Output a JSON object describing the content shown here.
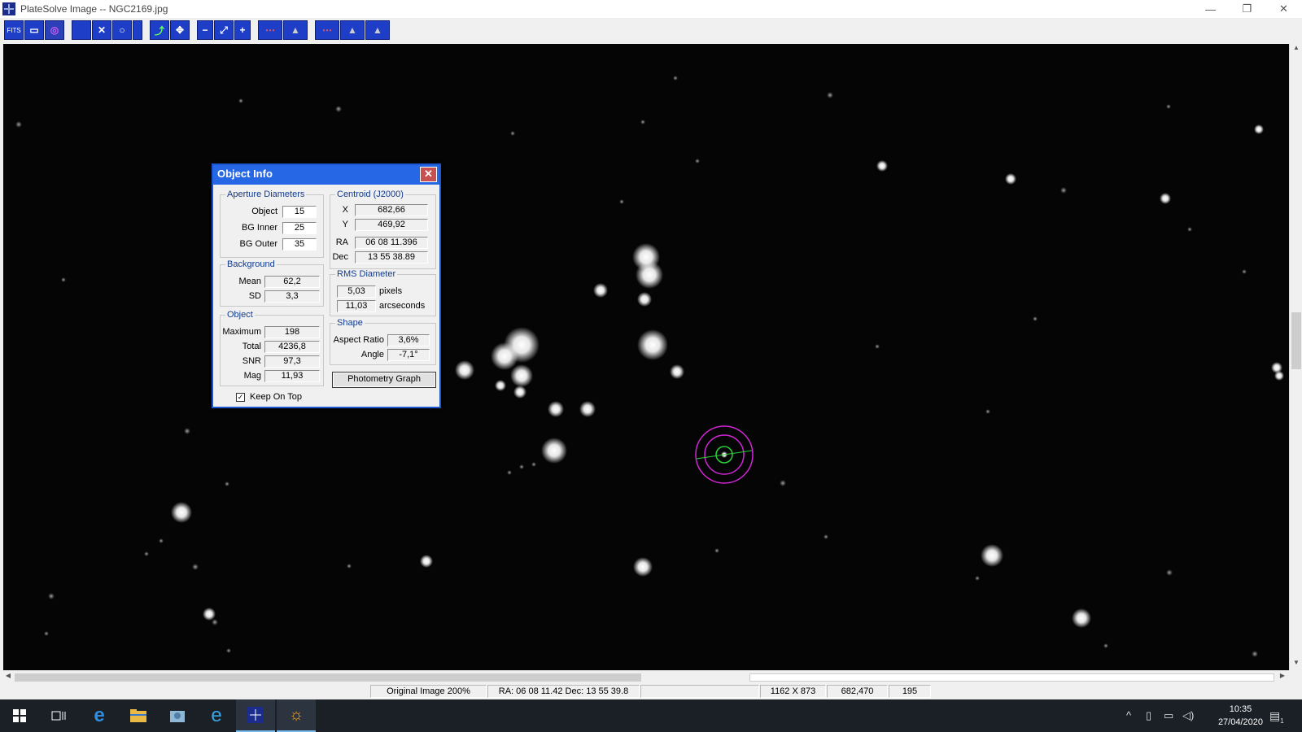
{
  "window": {
    "title": "PlateSolve Image -- NGC2169.jpg",
    "minimize": "—",
    "restore": "❐",
    "close": "✕"
  },
  "toolbar": {
    "buttons": [
      {
        "name": "fits-button",
        "label": "FITS"
      },
      {
        "name": "panel-button",
        "label": "▭"
      },
      {
        "name": "aperture-button",
        "label": "◎"
      },
      {
        "name": "blank-button-1",
        "label": ""
      },
      {
        "name": "cross-button",
        "label": "✕"
      },
      {
        "name": "circle-button",
        "label": "○"
      },
      {
        "name": "blank-button-2",
        "label": ""
      },
      {
        "name": "align-button",
        "label": "⤴"
      },
      {
        "name": "move-button",
        "label": "✥"
      },
      {
        "name": "zoom-out-button",
        "label": "−"
      },
      {
        "name": "fit-button",
        "label": "⤢"
      },
      {
        "name": "zoom-in-button",
        "label": "+"
      },
      {
        "name": "profile-h-button",
        "label": "⋯"
      },
      {
        "name": "peak-button",
        "label": "▲"
      },
      {
        "name": "profile-v-button",
        "label": "⋯"
      },
      {
        "name": "peak2-button",
        "label": "▲"
      },
      {
        "name": "peak3-button",
        "label": "▲"
      }
    ]
  },
  "dialog": {
    "title": "Object Info",
    "close": "✕",
    "aperture": {
      "label": "Aperture Diameters",
      "object_label": "Object",
      "object": "15",
      "bg_inner_label": "BG Inner",
      "bg_inner": "25",
      "bg_outer_label": "BG Outer",
      "bg_outer": "35"
    },
    "centroid": {
      "label": "Centroid (J2000)",
      "x_label": "X",
      "x": "682,66",
      "y_label": "Y",
      "y": "469,92",
      "ra_label": "RA",
      "ra": "06 08 11.396",
      "dec_label": "Dec",
      "dec": "13 55 38.89"
    },
    "background": {
      "label": "Background",
      "mean_label": "Mean",
      "mean": "62,2",
      "sd_label": "SD",
      "sd": "3,3"
    },
    "rms": {
      "label": "RMS Diameter",
      "pixels": "5,03",
      "pixels_unit": "pixels",
      "arcsec": "11,03",
      "arcsec_unit": "arcseconds"
    },
    "object": {
      "label": "Object",
      "max_label": "Maximum",
      "max": "198",
      "total_label": "Total",
      "total": "4236,8",
      "snr_label": "SNR",
      "snr": "97,3",
      "mag_label": "Mag",
      "mag": "11,93"
    },
    "shape": {
      "label": "Shape",
      "aspect_label": "Aspect Ratio",
      "aspect": "3,6%",
      "angle_label": "Angle",
      "angle": "-7,1°"
    },
    "photometry_button": "Photometry Graph",
    "keep_on_top": {
      "label": "Keep On Top",
      "checked": "✓"
    }
  },
  "statusbar": {
    "zoom": "Original Image 200%",
    "coords": "RA: 06 08 11.42  Dec: 13 55 39.8",
    "blank": "",
    "size": "1162 X 873",
    "pixel": "682,470",
    "value": "195"
  },
  "taskbar": {
    "time": "10:35",
    "date": "27/04/2020",
    "notifications": "1"
  }
}
